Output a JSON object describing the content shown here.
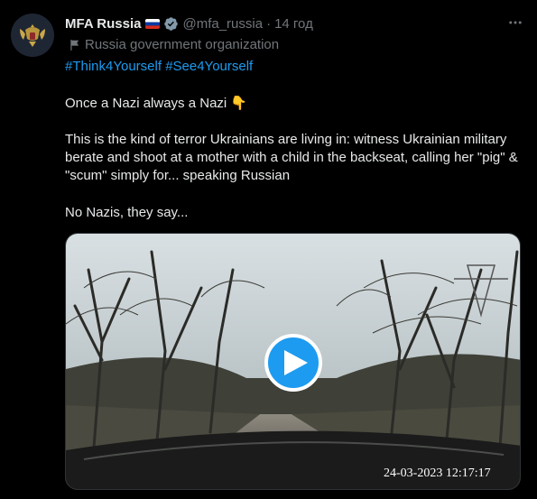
{
  "tweet": {
    "author_name": "MFA Russia",
    "flag_icon": "russia-flag-icon",
    "verified_icon": "verified-badge-icon",
    "verified_color": "#829aab",
    "handle": "@mfa_russia",
    "separator": "·",
    "time": "14 год",
    "more_icon": "more-options-icon",
    "affiliation_icon": "flag-label-icon",
    "affiliation_label": "Russia government organization",
    "hashtags": [
      "#Think4Yourself",
      "#See4Yourself"
    ],
    "line1": "Once a Nazi always a Nazi 👇",
    "line2": "This is the kind of terror Ukrainians are living in: witness Ukrainian military berate and shoot at a mother with a child in the backseat, calling her \"pig\" & \"scum\" simply for... speaking Russian",
    "line3": "No Nazis, they say...",
    "accent_color": "#1d9bf0"
  },
  "video": {
    "play_icon": "play-icon",
    "timestamp": "24-03-2023 12:17:17"
  }
}
